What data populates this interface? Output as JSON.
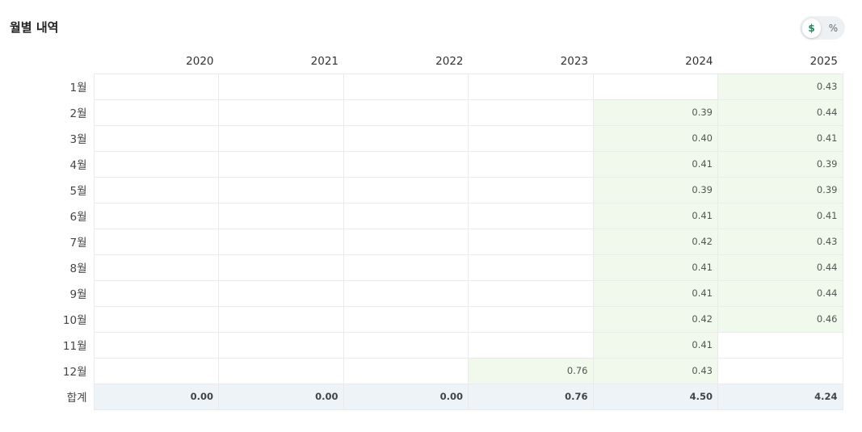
{
  "title": "월별 내역",
  "toggle": {
    "dollar": "$",
    "percent": "%"
  },
  "colors": {
    "filled": "#f1f9ec",
    "total_row": "#eef3f7",
    "accent": "#1d8a5a"
  },
  "years": [
    "2020",
    "2021",
    "2022",
    "2023",
    "2024",
    "2025"
  ],
  "rows": [
    {
      "month": "1월",
      "cells": [
        "",
        "",
        "",
        "",
        "",
        "0.43"
      ]
    },
    {
      "month": "2월",
      "cells": [
        "",
        "",
        "",
        "",
        "0.39",
        "0.44"
      ]
    },
    {
      "month": "3월",
      "cells": [
        "",
        "",
        "",
        "",
        "0.40",
        "0.41"
      ]
    },
    {
      "month": "4월",
      "cells": [
        "",
        "",
        "",
        "",
        "0.41",
        "0.39"
      ]
    },
    {
      "month": "5월",
      "cells": [
        "",
        "",
        "",
        "",
        "0.39",
        "0.39"
      ]
    },
    {
      "month": "6월",
      "cells": [
        "",
        "",
        "",
        "",
        "0.41",
        "0.41"
      ]
    },
    {
      "month": "7월",
      "cells": [
        "",
        "",
        "",
        "",
        "0.42",
        "0.43"
      ]
    },
    {
      "month": "8월",
      "cells": [
        "",
        "",
        "",
        "",
        "0.41",
        "0.44"
      ]
    },
    {
      "month": "9월",
      "cells": [
        "",
        "",
        "",
        "",
        "0.41",
        "0.44"
      ]
    },
    {
      "month": "10월",
      "cells": [
        "",
        "",
        "",
        "",
        "0.42",
        "0.46"
      ]
    },
    {
      "month": "11월",
      "cells": [
        "",
        "",
        "",
        "",
        "0.41",
        ""
      ]
    },
    {
      "month": "12월",
      "cells": [
        "",
        "",
        "",
        "0.76",
        "0.43",
        ""
      ]
    }
  ],
  "total": {
    "label": "합계",
    "cells": [
      "0.00",
      "0.00",
      "0.00",
      "0.76",
      "4.50",
      "4.24"
    ]
  }
}
